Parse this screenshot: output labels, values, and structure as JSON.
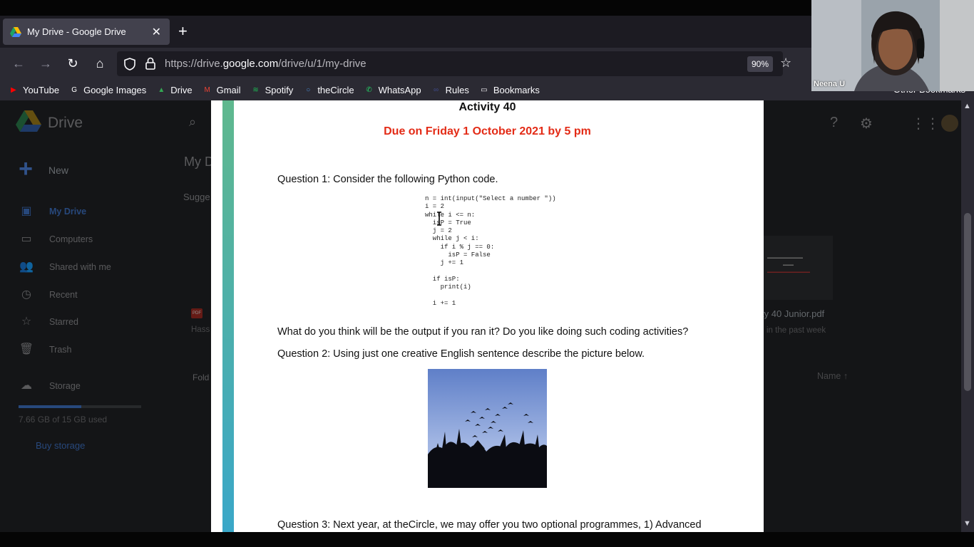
{
  "browser": {
    "tab": {
      "title": "My Drive - Google Drive"
    },
    "url": {
      "prefix": "https://drive.",
      "domain": "google.com",
      "suffix": "/drive/u/1/my-drive"
    },
    "zoom": "90%",
    "bookmarks": [
      {
        "label": "YouTube",
        "color": "#ff0000",
        "glyph": "▶"
      },
      {
        "label": "Google Images",
        "color": "#ffffff",
        "glyph": "G"
      },
      {
        "label": "Drive",
        "color": "#34a853",
        "glyph": "▲"
      },
      {
        "label": "Gmail",
        "color": "#ea4335",
        "glyph": "M"
      },
      {
        "label": "Spotify",
        "color": "#1db954",
        "glyph": "≋"
      },
      {
        "label": "theCircle",
        "color": "#4a8fd8",
        "glyph": "○"
      },
      {
        "label": "WhatsApp",
        "color": "#25d366",
        "glyph": "✆"
      },
      {
        "label": "Rules",
        "color": "#3f4a8a",
        "glyph": "∞"
      },
      {
        "label": "Bookmarks",
        "color": "#fbfbfe",
        "glyph": "▭"
      }
    ],
    "other_bookmarks": "Other Bookmarks"
  },
  "drive": {
    "title": "Drive",
    "new_label": "New",
    "nav": [
      {
        "label": "My Drive",
        "icon": "my-drive-icon",
        "glyph": "▣",
        "active": true
      },
      {
        "label": "Computers",
        "icon": "computers-icon",
        "glyph": "▭",
        "active": false
      },
      {
        "label": "Shared with me",
        "icon": "shared-icon",
        "glyph": "👥",
        "active": false
      },
      {
        "label": "Recent",
        "icon": "clock-icon",
        "glyph": "◷",
        "active": false
      },
      {
        "label": "Starred",
        "icon": "star-icon",
        "glyph": "☆",
        "active": false
      },
      {
        "label": "Trash",
        "icon": "trash-icon",
        "glyph": "🗑",
        "active": false
      }
    ],
    "storage_label": "Storage",
    "storage_used": "7.66 GB of 15 GB used",
    "storage_fraction": 0.51,
    "buy_storage": "Buy storage",
    "heading": "My D",
    "suggested": "Sugge",
    "folders": "Fold",
    "file_name": "ty 40 Junior.pdf",
    "file_edited": "in the past week",
    "sort_label": "Name",
    "hass": "Hass",
    "accent": "#3d6fbf"
  },
  "pdf": {
    "title": "Activity 40",
    "due": "Due on Friday 1 October 2021 by 5 pm",
    "q1": "Question 1: Consider the following Python code.",
    "code": "n = int(input(\"Select a number \"))\ni = 2\nwhile i <= n:\n  isP = True\n  j = 2\n  while j < i:\n    if i % j == 0:\n      isP = False\n    j += 1\n\n  if isP:\n    print(i)\n\n  i += 1",
    "q1b": "What do you think will be the output if you ran it? Do you like doing such coding activities?",
    "q2": "Question 2: Using just one creative English sentence describe the picture below.",
    "q3": "Question 3: Next year, at theCircle, we may offer you two optional programmes, 1) Advanced",
    "due_color": "#e32b16"
  },
  "webcam": {
    "name": "Neena U"
  }
}
